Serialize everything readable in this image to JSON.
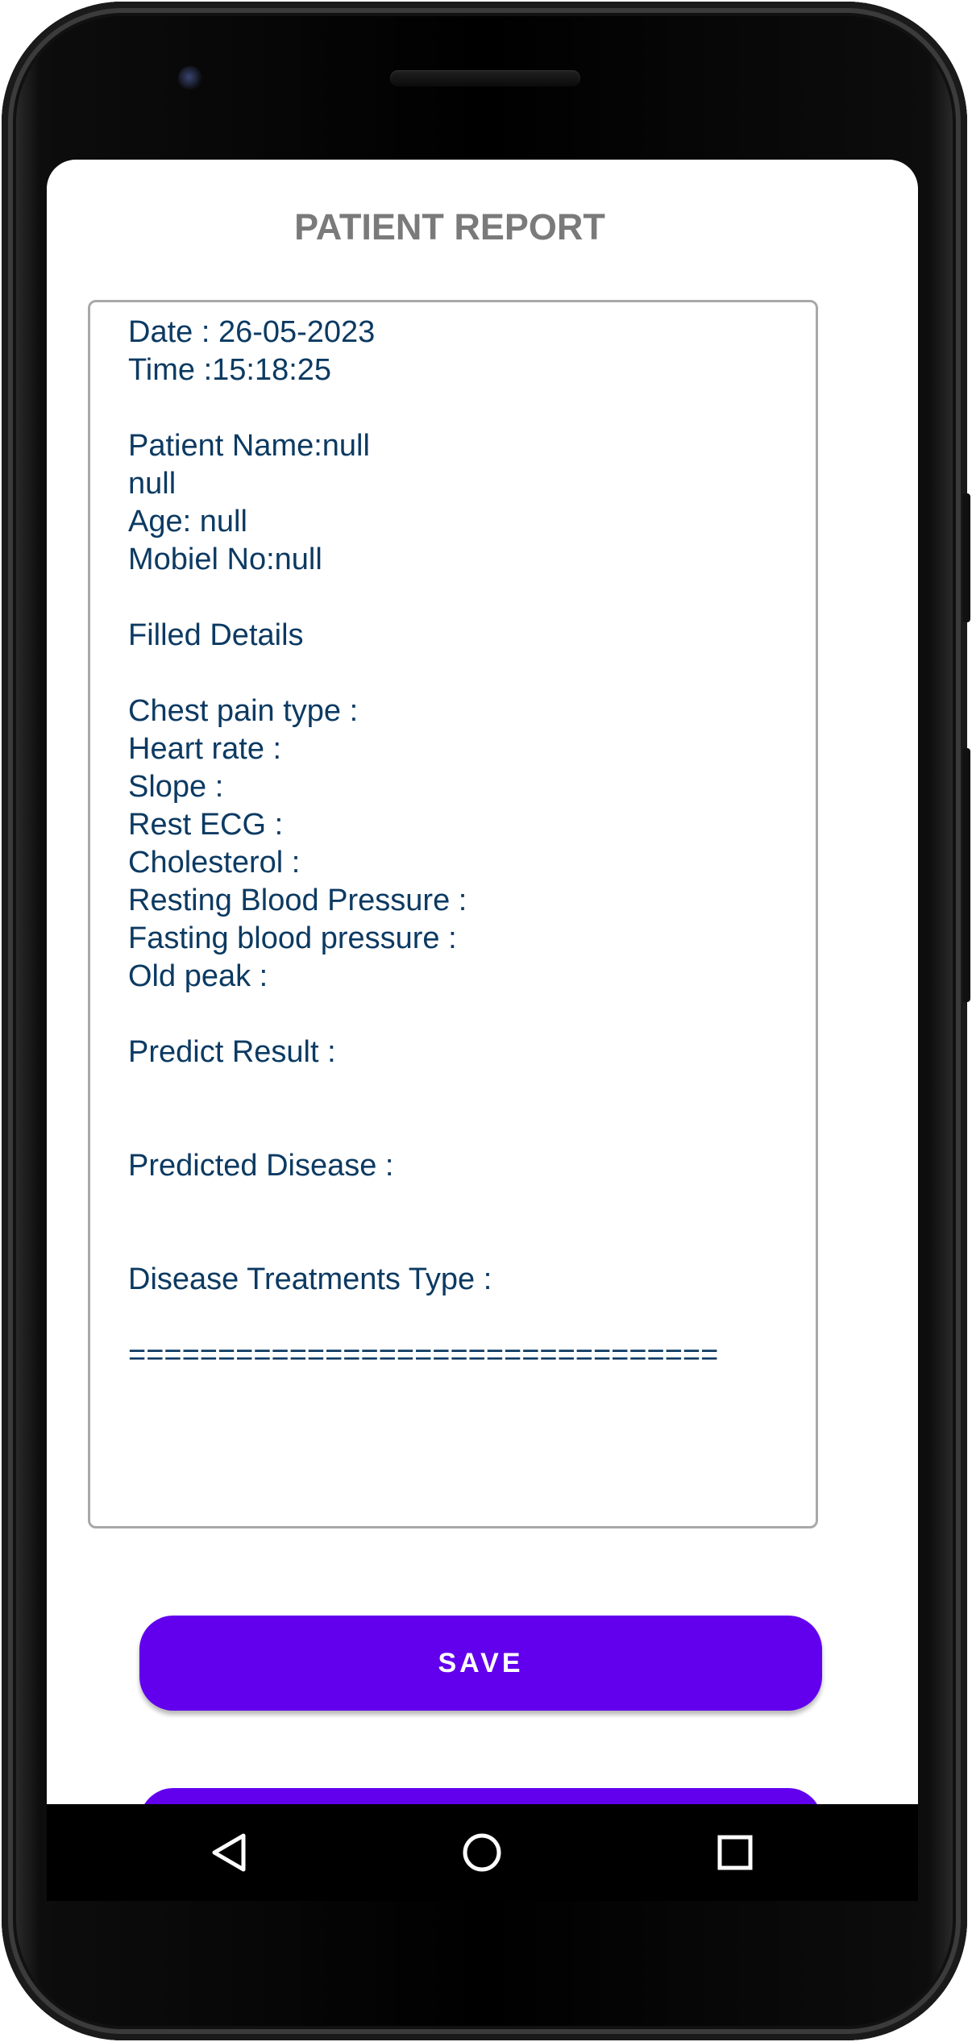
{
  "title": "PATIENT REPORT",
  "report": {
    "lines": [
      "Date : 26-05-2023",
      "Time :15:18:25",
      "",
      "Patient Name:null",
      "null",
      "Age: null",
      "Mobiel No:null",
      "",
      "Filled Details",
      "",
      "Chest pain type :",
      "Heart rate :",
      "Slope :",
      "Rest ECG :",
      "Cholesterol :",
      "Resting Blood Pressure :",
      "Fasting blood pressure :",
      "Old peak :",
      "",
      "Predict Result :",
      "",
      "",
      "Predicted Disease :",
      "",
      "",
      "Disease Treatments Type :",
      "",
      "================================="
    ]
  },
  "buttons": {
    "save_label": "SAVE"
  },
  "navbar": {
    "back_icon": "back-triangle-icon",
    "home_icon": "home-circle-icon",
    "recent_icon": "recents-square-icon"
  },
  "colors": {
    "accent": "#6200ee",
    "report_text": "#0c3a62",
    "title": "#7a7a7a"
  }
}
